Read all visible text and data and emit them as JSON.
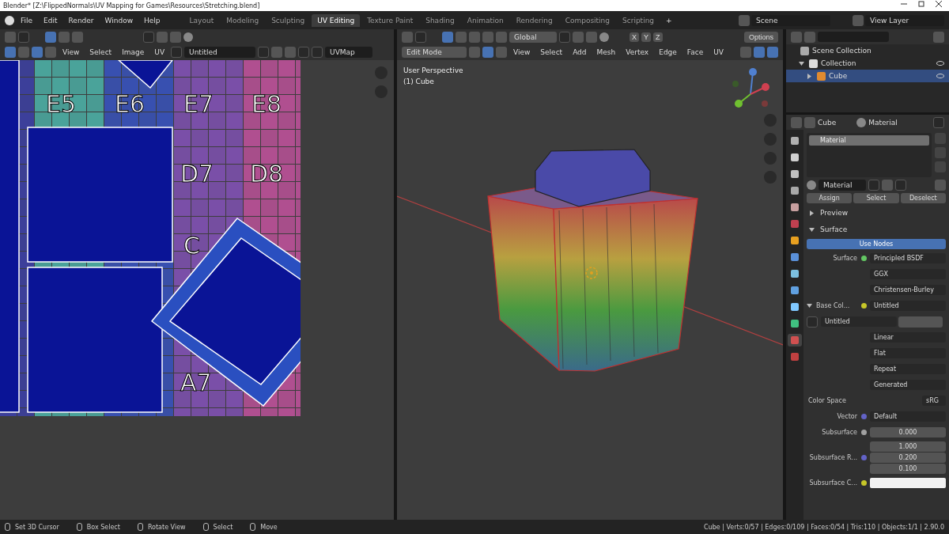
{
  "title_bar": {
    "title": "Blender* [Z:\\FlippedNormals\\UV Mapping for Games\\Resources\\Stretching.blend]"
  },
  "menu": [
    "File",
    "Edit",
    "Render",
    "Window",
    "Help"
  ],
  "workspaces": [
    {
      "label": "Layout",
      "selected": false
    },
    {
      "label": "Modeling",
      "selected": false
    },
    {
      "label": "Sculpting",
      "selected": false
    },
    {
      "label": "UV Editing",
      "selected": true
    },
    {
      "label": "Texture Paint",
      "selected": false
    },
    {
      "label": "Shading",
      "selected": false
    },
    {
      "label": "Animation",
      "selected": false
    },
    {
      "label": "Rendering",
      "selected": false
    },
    {
      "label": "Compositing",
      "selected": false
    },
    {
      "label": "Scripting",
      "selected": false
    }
  ],
  "add_workspace": "+",
  "scene": "Scene",
  "view_layer": "View Layer",
  "uv_editor": {
    "header_menus": [
      "View",
      "Select",
      "Image",
      "UV"
    ],
    "image": "Untitled",
    "uv_map": "UVMap",
    "texture_labels": [
      "E5",
      "E6",
      "E7",
      "E8",
      "D7",
      "D8",
      "C",
      "A7"
    ]
  },
  "viewport": {
    "orientation": "Global",
    "mirror_axes": [
      "X",
      "Y",
      "Z"
    ],
    "options": "Options",
    "mode": "Edit Mode",
    "header_menus": [
      "View",
      "Select",
      "Add",
      "Mesh",
      "Vertex",
      "Edge",
      "Face",
      "UV"
    ],
    "overlay": [
      "User Perspective",
      "(1) Cube"
    ]
  },
  "outliner": {
    "items": [
      {
        "label": "Scene Collection",
        "children": [
          {
            "label": "Collection",
            "expanded": true,
            "selected": false,
            "children": [
              {
                "label": "Cube",
                "expanded": false,
                "selected": true
              }
            ]
          }
        ]
      }
    ]
  },
  "properties": {
    "object": "Cube",
    "context": "Material",
    "tabs": [
      {
        "color": "#b0b0b0",
        "selected": false
      },
      {
        "color": "#d0d0d0",
        "selected": false
      },
      {
        "color": "#c0c0c0",
        "selected": false
      },
      {
        "color": "#a8a8a8",
        "selected": false
      },
      {
        "color": "#c8a0a0",
        "selected": false
      },
      {
        "color": "#c04050",
        "selected": false
      },
      {
        "color": "#e8a020",
        "selected": false
      },
      {
        "color": "#5a90d8",
        "selected": false
      },
      {
        "color": "#7cc0e0",
        "selected": false
      },
      {
        "color": "#60a0e0",
        "selected": false
      },
      {
        "color": "#80c8ff",
        "selected": false
      },
      {
        "color": "#40c080",
        "selected": false
      },
      {
        "color": "#d05050",
        "selected": true
      },
      {
        "color": "#c04040",
        "selected": false
      }
    ],
    "slots": [
      {
        "name": "Material",
        "selected": true
      }
    ],
    "material": "Material",
    "slot_buttons": [
      "Assign",
      "Select",
      "Deselect"
    ],
    "panels": [
      {
        "label": "Preview",
        "expanded": false
      },
      {
        "label": "Surface",
        "expanded": true
      }
    ],
    "use_nodes": "Use Nodes",
    "rows": [
      {
        "kind": "link",
        "label": "Surface",
        "value": "Principled BSDF",
        "color": "#63c763"
      },
      {
        "kind": "dropdown",
        "value": "GGX"
      },
      {
        "kind": "dropdown",
        "value": "Christensen-Burley"
      },
      {
        "kind": "group",
        "label": "Base Col...",
        "value": "Untitled",
        "color": "#c7c729"
      },
      {
        "kind": "image",
        "value": "Untitled"
      },
      {
        "kind": "dropdown",
        "value": "Linear"
      },
      {
        "kind": "dropdown",
        "value": "Flat"
      },
      {
        "kind": "dropdown",
        "value": "Repeat"
      },
      {
        "kind": "dropdown",
        "value": "Generated"
      },
      {
        "kind": "select",
        "label": "Color Space",
        "value": "sRG"
      },
      {
        "kind": "link",
        "label": "Vector",
        "value": "Default",
        "color": "#6363c7"
      },
      {
        "kind": "number",
        "label": "Subsurface",
        "values": [
          "0.000"
        ],
        "color": "#a1a1a1"
      },
      {
        "kind": "number",
        "label": "Subsurface R...",
        "values": [
          "1.000",
          "0.200",
          "0.100"
        ],
        "color": "#6363c7"
      },
      {
        "kind": "color",
        "label": "Subsurface C...",
        "color": "#c7c729"
      }
    ]
  },
  "status_bar": {
    "hints": [
      "Set 3D Cursor",
      "Box Select",
      "Rotate View",
      "Select",
      "Move"
    ],
    "stats": "Cube | Verts:0/57 | Edges:0/109 | Faces:0/54 | Tris:110 | Objects:1/1 | 2.90.0"
  }
}
